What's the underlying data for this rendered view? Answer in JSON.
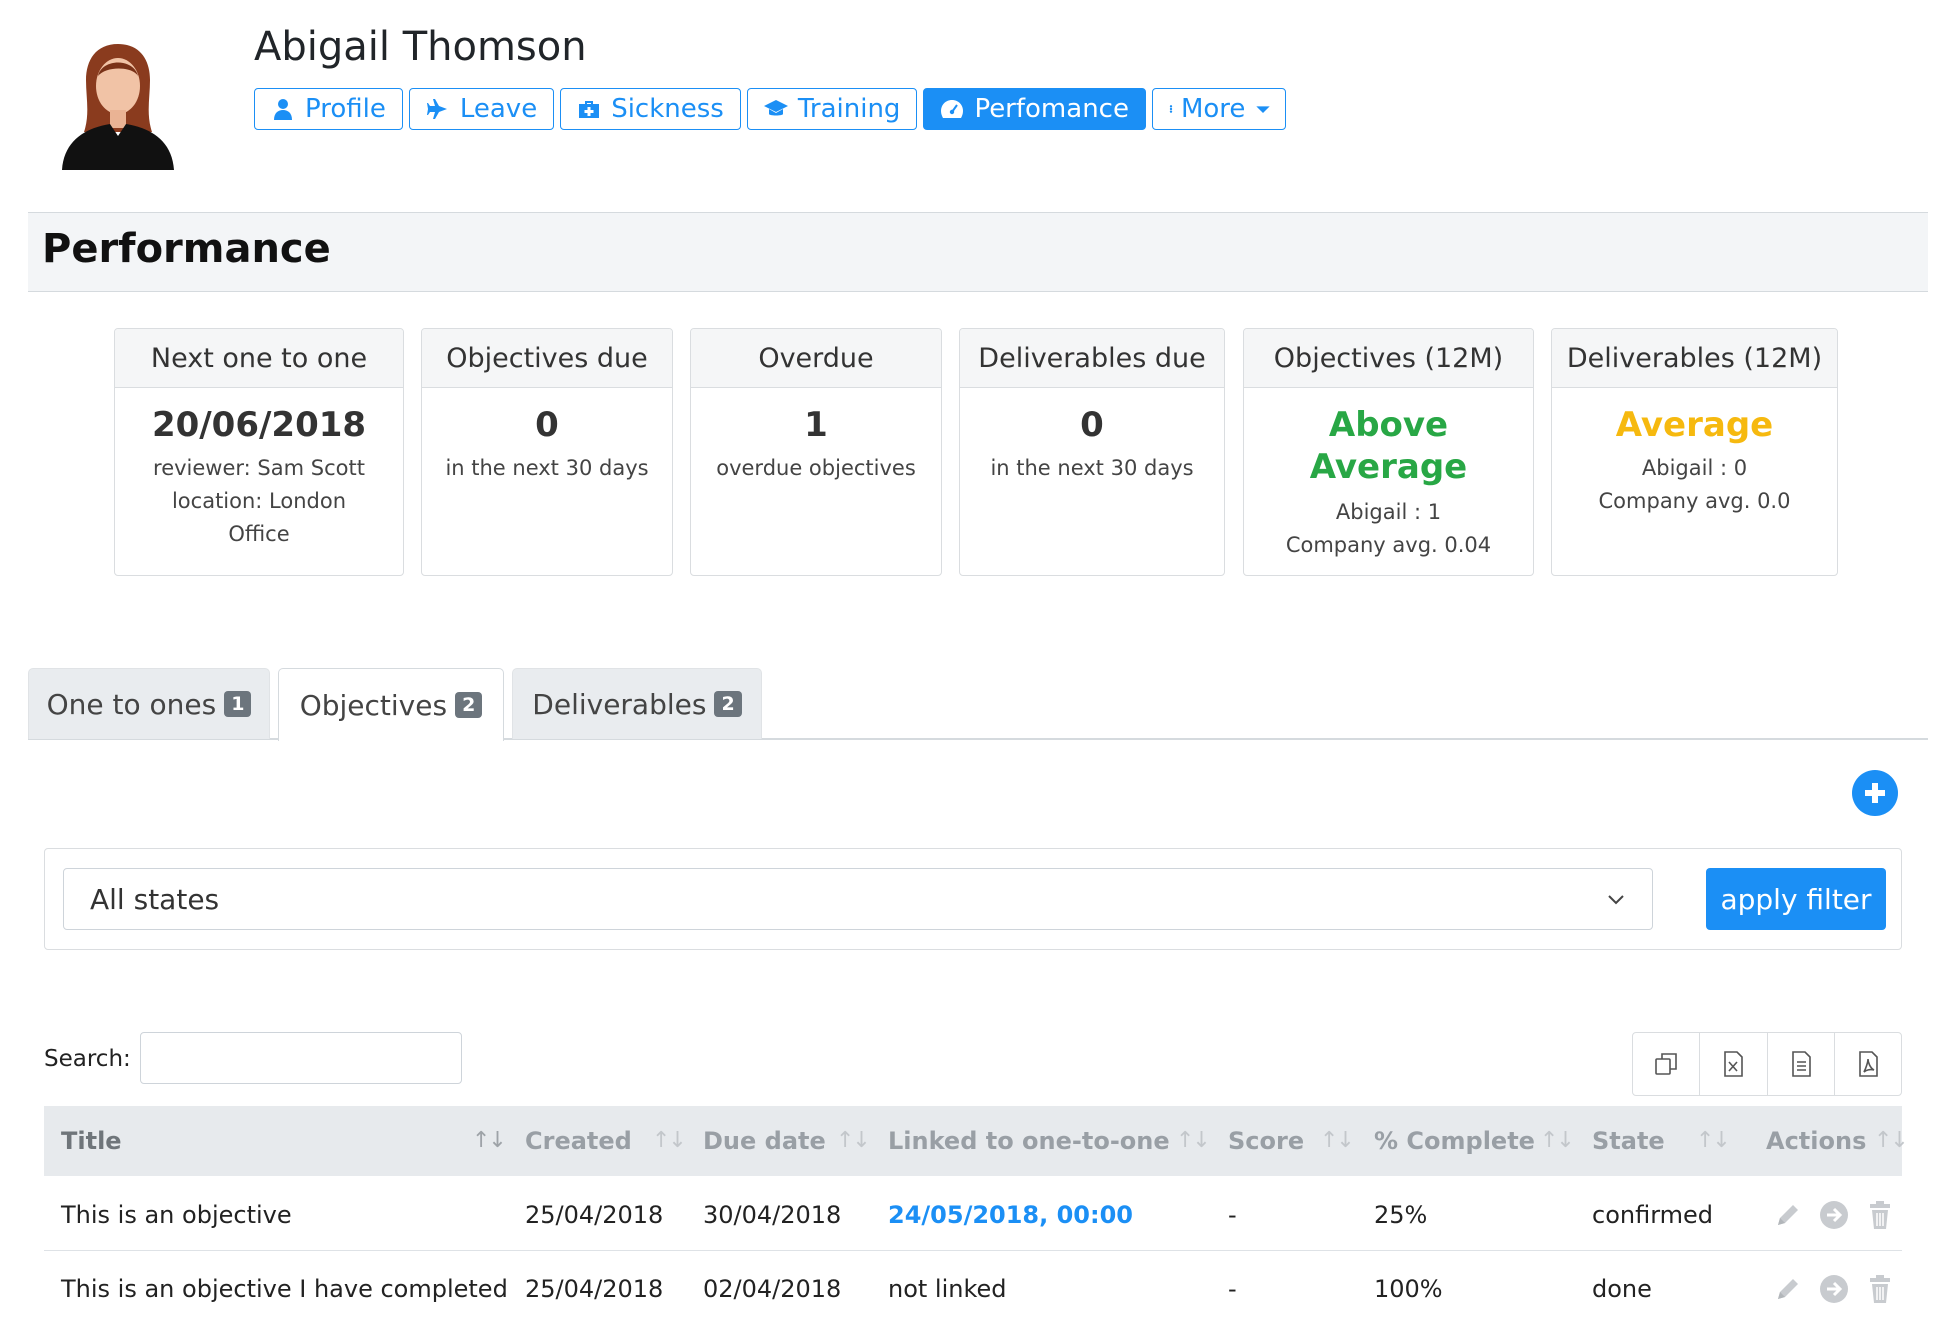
{
  "employee": {
    "name": "Abigail Thomson"
  },
  "nav": {
    "items": [
      {
        "label": "Profile",
        "icon": "user-icon"
      },
      {
        "label": "Leave",
        "icon": "plane-icon"
      },
      {
        "label": "Sickness",
        "icon": "medkit-icon"
      },
      {
        "label": "Training",
        "icon": "graduation-cap-icon"
      },
      {
        "label": "Perfomance",
        "icon": "dashboard-icon",
        "active": true
      },
      {
        "label": "More",
        "icon": "ellipsis-vertical-icon"
      }
    ]
  },
  "section": {
    "title": "Performance"
  },
  "cards": [
    {
      "header": "Next one to one",
      "value": "20/06/2018",
      "lines": [
        "reviewer: Sam Scott",
        "location: London",
        "Office"
      ]
    },
    {
      "header": "Objectives due",
      "value": "0",
      "lines": [
        "in the next 30 days"
      ]
    },
    {
      "header": "Overdue",
      "value": "1",
      "lines": [
        "overdue objectives"
      ]
    },
    {
      "header": "Deliverables due",
      "value": "0",
      "lines": [
        "in the next 30 days"
      ]
    },
    {
      "header": "Objectives (12M)",
      "value_lines": [
        "Above",
        "Average"
      ],
      "lines": [
        "Abigail : 1",
        "Company avg. 0.04"
      ],
      "color": "#28a745"
    },
    {
      "header": "Deliverables (12M)",
      "value": "Average",
      "lines": [
        "Abigail : 0",
        "Company avg. 0.0"
      ],
      "color": "#f6b90f"
    }
  ],
  "tabs": [
    {
      "label": "One to ones",
      "badge": "1"
    },
    {
      "label": "Objectives",
      "badge": "2",
      "active": true
    },
    {
      "label": "Deliverables",
      "badge": "2"
    }
  ],
  "filter": {
    "selected": "All states",
    "apply_label": "apply filter"
  },
  "search": {
    "label": "Search:",
    "value": ""
  },
  "export_buttons": [
    "copy-icon",
    "excel-icon",
    "csv-icon",
    "pdf-icon"
  ],
  "table": {
    "columns": [
      "Title",
      "Created",
      "Due date",
      "Linked to one-to-one",
      "Score",
      "% Complete",
      "State",
      "Actions"
    ],
    "rows": [
      {
        "title": "This is an objective",
        "created": "25/04/2018",
        "due": "30/04/2018",
        "linked": "24/05/2018, 00:00",
        "linked_is_link": true,
        "score": "-",
        "complete": "25%",
        "state": "confirmed"
      },
      {
        "title": "This is an objective I have completed",
        "created": "25/04/2018",
        "due": "02/04/2018",
        "linked": "not linked",
        "linked_is_link": false,
        "score": "-",
        "complete": "100%",
        "state": "done"
      }
    ]
  },
  "colors": {
    "accent": "#1b8ff5",
    "above_average": "#28a745",
    "average": "#f6b90f"
  }
}
